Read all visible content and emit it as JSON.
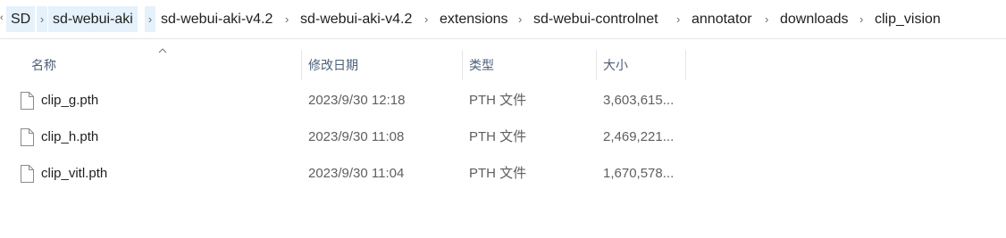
{
  "breadcrumb": {
    "lead_chevron": "‹",
    "items": [
      {
        "label": "SD"
      },
      {
        "label": "sd-webui-aki"
      },
      {
        "label": "sd-webui-aki-v4.2"
      },
      {
        "label": "sd-webui-aki-v4.2"
      },
      {
        "label": "extensions"
      },
      {
        "label": "sd-webui-controlnet"
      },
      {
        "label": "annotator"
      },
      {
        "label": "downloads"
      },
      {
        "label": "clip_vision"
      }
    ],
    "separator": "›"
  },
  "columns": {
    "name": "名称",
    "modified": "修改日期",
    "type": "类型",
    "size": "大小",
    "sorted_by": "name",
    "sort_icon": "sort-up-chevron-icon"
  },
  "files": [
    {
      "name": "clip_g.pth",
      "modified": "2023/9/30 12:18",
      "type": "PTH 文件",
      "size": "3,603,615...",
      "icon": "file-icon"
    },
    {
      "name": "clip_h.pth",
      "modified": "2023/9/30 11:08",
      "type": "PTH 文件",
      "size": "2,469,221...",
      "icon": "file-icon"
    },
    {
      "name": "clip_vitl.pth",
      "modified": "2023/9/30 11:04",
      "type": "PTH 文件",
      "size": "1,670,578...",
      "icon": "file-icon"
    }
  ],
  "colors": {
    "breadcrumb_highlight": "#e5f1fb",
    "header_text": "#4c607a",
    "meta_text": "#5f5f5f"
  }
}
